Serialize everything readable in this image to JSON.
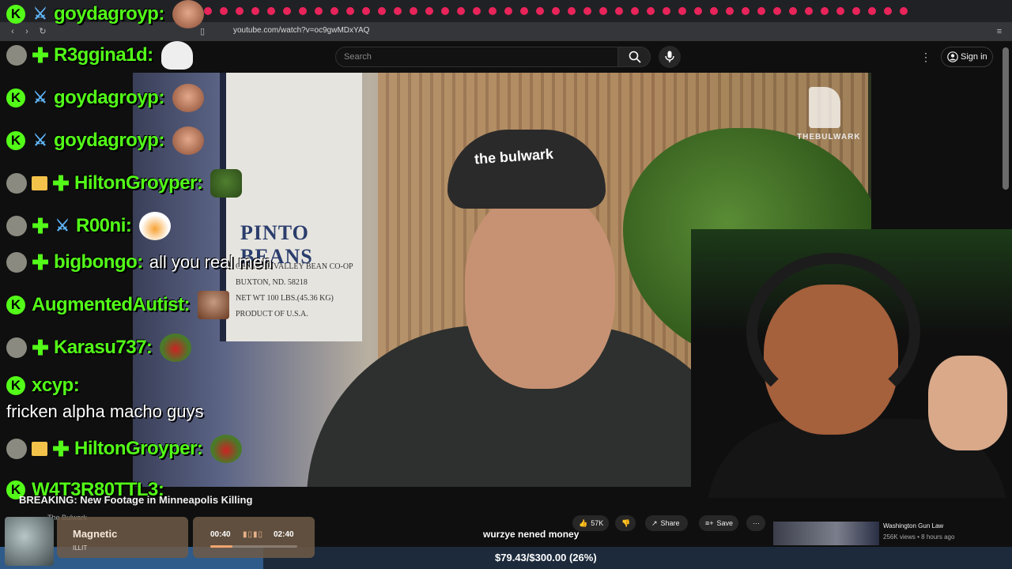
{
  "browser": {
    "url": "youtube.com/watch?v=oc9gwMDxYAQ"
  },
  "youtube": {
    "search_placeholder": "Search",
    "signin_label": "Sign in"
  },
  "video": {
    "poster_text": "PINTO BEANS",
    "poster_lines": [
      "CENTRAL VALLEY BEAN CO-OP",
      "BUXTON, ND. 58218",
      "NET WT 100 LBS.(45.36 KG)",
      "PRODUCT OF U.S.A."
    ],
    "cap_text": "the bulwark",
    "watermark": "THEBULWARK",
    "title": "BREAKING: New Footage in Minneapolis Killing",
    "channel": "The Bulwark",
    "caption": "wurzye nened money",
    "likes": "57K",
    "share_label": "Share",
    "save_label": "Save"
  },
  "chat": [
    {
      "user": "goydagroyp:",
      "badges": [
        "k",
        "sword"
      ],
      "emote": "face",
      "message": ""
    },
    {
      "user": "R3ggina1d:",
      "badges": [
        "avatar",
        "plus"
      ],
      "emote": "ghost",
      "message": ""
    },
    {
      "user": "goydagroyp:",
      "badges": [
        "k",
        "sword"
      ],
      "emote": "face",
      "message": ""
    },
    {
      "user": "goydagroyp:",
      "badges": [
        "k",
        "sword"
      ],
      "emote": "face",
      "message": ""
    },
    {
      "user": "HiltonGroyper:",
      "badges": [
        "avatar",
        "gift",
        "plus"
      ],
      "emote": "pepe",
      "message": ""
    },
    {
      "user": "R00ni:",
      "badges": [
        "avatar",
        "plus",
        "sword"
      ],
      "emote": "bowl",
      "message": ""
    },
    {
      "user": "bigbongo:",
      "badges": [
        "avatar",
        "plus"
      ],
      "emote": "",
      "message": "all you real men"
    },
    {
      "user": "AugmentedAutist:",
      "badges": [
        "k"
      ],
      "emote": "mix",
      "message": ""
    },
    {
      "user": "Karasu737:",
      "badges": [
        "avatar",
        "plus"
      ],
      "emote": "frog",
      "message": ""
    },
    {
      "user": "xcyp:",
      "badges": [
        "k"
      ],
      "emote": "",
      "message": ""
    },
    {
      "user": "HiltonGroyper:",
      "badges": [
        "avatar",
        "gift",
        "plus"
      ],
      "emote": "frog",
      "message": ""
    },
    {
      "user": "W4T3R80TTL3:",
      "badges": [
        "k"
      ],
      "emote": "",
      "message": ""
    }
  ],
  "chat_full_message": "fricken alpha macho guys",
  "music": {
    "title": "Magnetic",
    "artist": "ILLIT",
    "elapsed": "00:40",
    "total": "02:40",
    "progress": 0.25
  },
  "recommendation": {
    "title": "Washington Gun Law",
    "meta": "256K views • 8 hours ago"
  },
  "goal": {
    "text": "$79.43/$300.00 (26%)",
    "fraction": 0.26
  },
  "colors": {
    "kick_green": "#53fc18",
    "youtube_link_blue": "#3ea6ff",
    "goal_fill": "#2f5b8a"
  }
}
